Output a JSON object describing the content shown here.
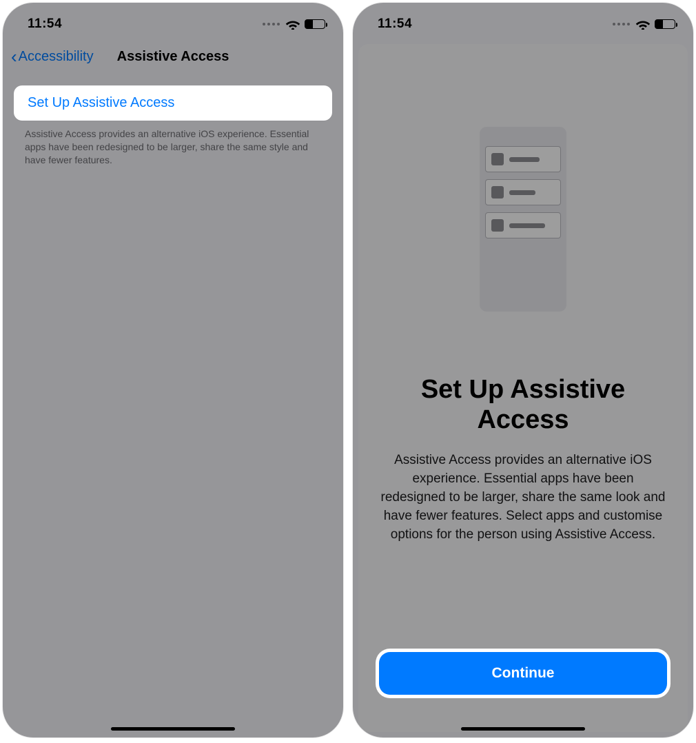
{
  "status": {
    "time": "11:54"
  },
  "left": {
    "back_label": "Accessibility",
    "title": "Assistive Access",
    "setup_label": "Set Up Assistive Access",
    "footer": "Assistive Access provides an alternative iOS experience. Essential apps have been redesigned to be larger, share the same style and have fewer features."
  },
  "right": {
    "title": "Set Up Assistive Access",
    "body": "Assistive Access provides an alternative iOS experience. Essential apps have been redesigned to be larger, share the same look and have fewer features. Select apps and customise options for the person using Assistive Access.",
    "continue_label": "Continue"
  }
}
